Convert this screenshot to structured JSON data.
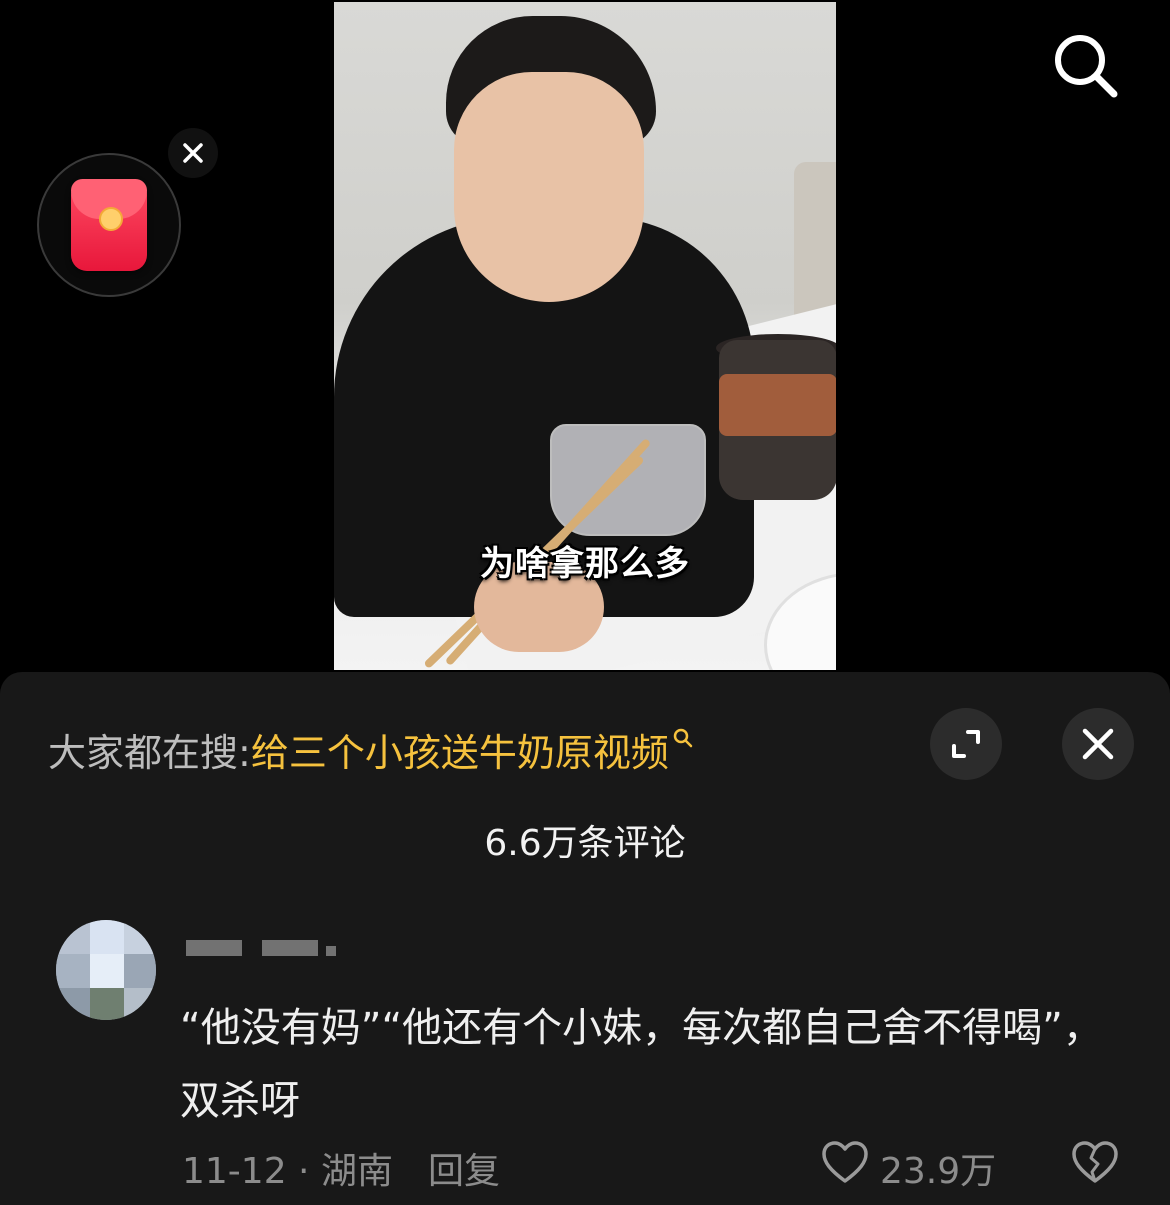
{
  "video": {
    "subtitle": "为啥拿那么多"
  },
  "hot_search": {
    "prefix": "大家都在搜:",
    "query": "给三个小孩送牛奶原视频"
  },
  "comments": {
    "count_label": "6.6万条评论",
    "items": [
      {
        "text": "“他没有妈”“他还有个小妹，每次都自己舍不得喝”，双杀呀",
        "date": "11-12",
        "location": "湖南",
        "reply_label": "回复",
        "likes": "23.9万"
      }
    ]
  },
  "icons": {
    "search": "search-icon",
    "red_packet": "red-packet-icon",
    "close": "close-icon",
    "expand": "expand-icon",
    "heart": "heart-icon",
    "broken_heart": "broken-heart-icon"
  },
  "colors": {
    "accent_query": "#f6c23e",
    "panel_bg": "#181818",
    "muted_text": "#8c8c8c"
  }
}
